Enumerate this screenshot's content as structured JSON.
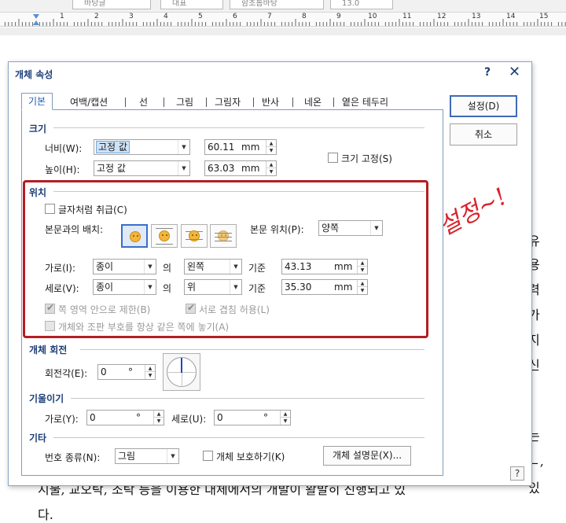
{
  "toolbar": {
    "style_combo": "바탕글",
    "font_lang_combo": "대표",
    "font_combo": "함초롬바탕",
    "size_combo": "13.0"
  },
  "ruler": {
    "numbers": [
      "1",
      "2",
      "3",
      "4",
      "5",
      "6",
      "7",
      "8",
      "9",
      "10",
      "11",
      "12",
      "13",
      "14",
      "15"
    ]
  },
  "document": {
    "side_chars": [
      "유",
      "용",
      "력",
      "가",
      "지",
      "신",
      "는",
      "ㄴ,",
      "있"
    ],
    "bottom_line": "지불, 교오탁, 조탁 등을 이용한 대체에서의 개발이 활발히 진행되고 있",
    "last_line": "다."
  },
  "dialog": {
    "title": "개체 속성",
    "help_label": "?",
    "close_label": "✕",
    "tabs": [
      "기본",
      "여백/캡션",
      "선",
      "그림",
      "그림자",
      "반사",
      "네온",
      "옅은 테두리"
    ],
    "ok_label": "설정(D)",
    "cancel_label": "취소",
    "size": {
      "title": "크기",
      "width_label": "너비(W):",
      "width_mode": "고정 값",
      "width_value": "60.11",
      "height_label": "높이(H):",
      "height_mode": "고정 값",
      "height_value": "63.03",
      "unit": "mm",
      "lock_label": "크기 고정(S)"
    },
    "position": {
      "title": "위치",
      "treat_as_char_label": "글자처럼 취급(C)",
      "wrap_label": "본문과의 배치:",
      "body_pos_label": "본문 위치(P):",
      "body_pos_value": "양쪽",
      "horizontal_label": "가로(I):",
      "horizontal_ref": "종이",
      "horizontal_align": "왼쪽",
      "horizontal_value": "43.13",
      "vertical_label": "세로(V):",
      "vertical_ref": "종이",
      "vertical_align": "위",
      "vertical_value": "35.30",
      "of_label": "의",
      "basis_label": "기준",
      "unit": "mm",
      "limit_label": "쪽 영역 안으로 제한(B)",
      "overlap_label": "서로 겹침 허용(L)",
      "same_page_label": "개체와 조판 부호를 항상 같은 쪽에 놓기(A)"
    },
    "rotation": {
      "title": "개체 회전",
      "angle_label": "회전각(E):",
      "angle_value": "0",
      "degree": "°"
    },
    "skew": {
      "title": "기울이기",
      "horizontal_label": "가로(Y):",
      "horizontal_value": "0",
      "vertical_label": "세로(U):",
      "vertical_value": "0",
      "degree": "°"
    },
    "misc": {
      "title": "기타",
      "number_type_label": "번호 종류(N):",
      "number_type_value": "그림",
      "protect_label": "개체 보호하기(K)",
      "description_button": "개체 설명문(X)..."
    },
    "corner_help": "?"
  },
  "annotation": {
    "text": "설정~!",
    "color": "#d9232a"
  },
  "colors": {
    "accent": "#1d3f79",
    "highlight_border": "#b31e23",
    "selected_bg": "#cde3f7"
  }
}
